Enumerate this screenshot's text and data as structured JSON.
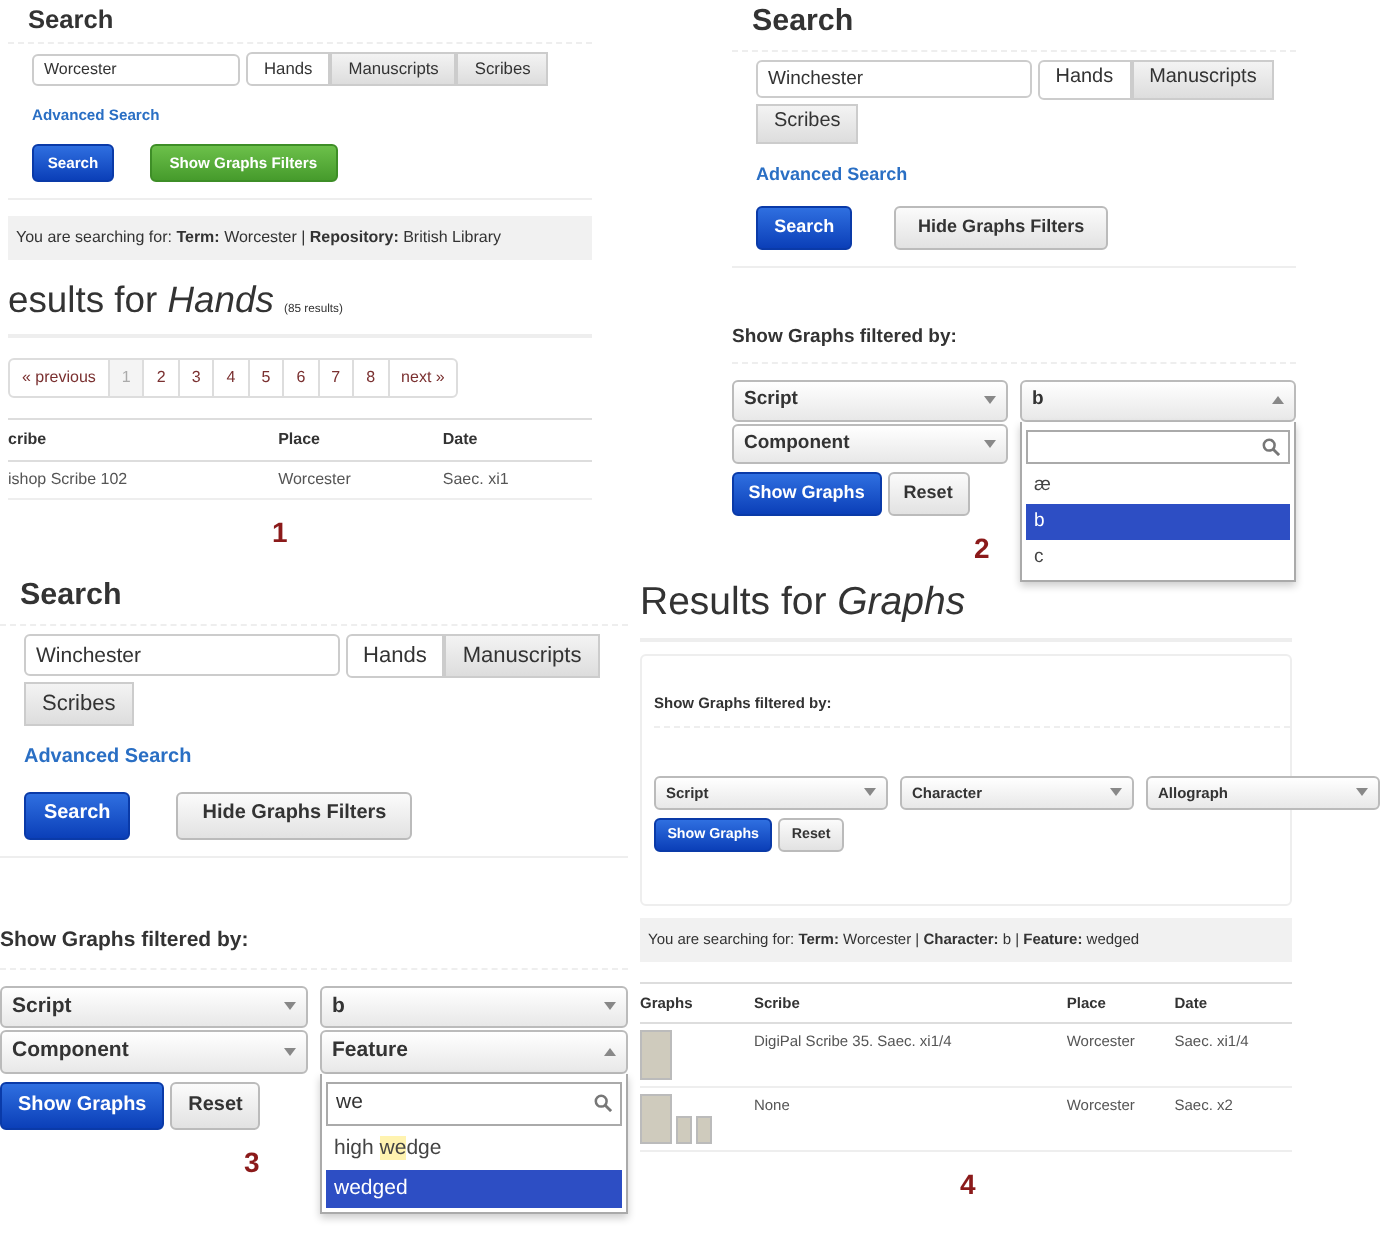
{
  "panels": [
    {
      "number": "1",
      "sections": [
        {
          "kind": "search",
          "heading": "Search",
          "query": "Worcester",
          "types": [
            {
              "label": "Hands",
              "selected": true
            },
            {
              "label": "Manuscripts",
              "selected": false
            },
            {
              "label": "Scribes",
              "selected": false
            }
          ],
          "advanced": "Advanced Search",
          "search_label": "Search",
          "toggle": {
            "label": "Show Graphs Filters",
            "kind": "show"
          }
        },
        {
          "kind": "summary",
          "text": "You are searching for: **Term:** Worcester | **Repository:** British Library"
        },
        {
          "kind": "results_title",
          "title": "esults for *Hands*",
          "count": "(85 results)"
        },
        {
          "kind": "pagination",
          "pages": [
            {
              "label": "« previous",
              "selected": false
            },
            {
              "label": "1",
              "selected": true
            },
            {
              "label": "2",
              "selected": false
            },
            {
              "label": "3",
              "selected": false
            },
            {
              "label": "4",
              "selected": false
            },
            {
              "label": "5",
              "selected": false
            },
            {
              "label": "6",
              "selected": false
            },
            {
              "label": "7",
              "selected": false
            },
            {
              "label": "8",
              "selected": false
            },
            {
              "label": "next »",
              "selected": false
            }
          ]
        },
        {
          "kind": "table",
          "columns": [
            "cribe",
            "Place",
            "Date"
          ],
          "rows": [
            {
              "cells": [
                {
                  "kind": "text",
                  "text": "ishop Scribe 102"
                },
                {
                  "kind": "text",
                  "text": "Worcester"
                },
                {
                  "kind": "text",
                  "text": "Saec. xi1"
                }
              ]
            }
          ]
        }
      ]
    },
    {
      "number": "2",
      "sections": [
        {
          "kind": "search",
          "heading": "Search",
          "query": "Winchester",
          "types": [
            {
              "label": "Hands",
              "selected": true
            },
            {
              "label": "Manuscripts",
              "selected": false
            },
            {
              "label": "Scribes",
              "selected": false
            }
          ],
          "advanced": "Advanced Search",
          "search_label": "Search",
          "toggle": {
            "label": "Hide Graphs Filters",
            "kind": "hide"
          }
        },
        {
          "kind": "filters",
          "title": "Show Graphs filtered by:",
          "boxed": false,
          "show_label": "Show Graphs",
          "reset_label": "Reset",
          "columns": [
            [
              {
                "label": "Script",
                "open": false
              },
              {
                "label": "Component",
                "open": false
              }
            ],
            [
              {
                "label": "b",
                "open": true,
                "options": [
                  {
                    "label": "æ",
                    "selected": false
                  },
                  {
                    "label": "b",
                    "selected": true
                  },
                  {
                    "label": "c",
                    "selected": false
                  }
                ]
              }
            ]
          ]
        }
      ]
    },
    {
      "number": "3",
      "sections": [
        {
          "kind": "search",
          "heading": "Search",
          "query": "Winchester",
          "types": [
            {
              "label": "Hands",
              "selected": true
            },
            {
              "label": "Manuscripts",
              "selected": false
            },
            {
              "label": "Scribes",
              "selected": false
            }
          ],
          "advanced": "Advanced Search",
          "search_label": "Search",
          "toggle": {
            "label": "Hide Graphs Filters",
            "kind": "hide"
          }
        },
        {
          "kind": "filters",
          "title": "Show Graphs filtered by:",
          "boxed": false,
          "show_label": "Show Graphs",
          "reset_label": "Reset",
          "columns": [
            [
              {
                "label": "Script",
                "open": false
              },
              {
                "label": "Component",
                "open": false
              }
            ],
            [
              {
                "label": "b",
                "open": false
              },
              {
                "label": "Feature",
                "open": true,
                "search": "we",
                "options": [
                  {
                    "parts": [
                      {
                        "text": "high "
                      },
                      {
                        "text": "we",
                        "highlight": true
                      },
                      {
                        "text": "dge"
                      }
                    ],
                    "selected": false
                  },
                  {
                    "label": "wedged",
                    "selected": true
                  }
                ]
              }
            ]
          ]
        }
      ]
    },
    {
      "number": "4",
      "sections": [
        {
          "kind": "results_title",
          "title": "Results for *Graphs*"
        },
        {
          "kind": "filters",
          "title": "Show Graphs filtered by:",
          "boxed": true,
          "show_label": "Show Graphs",
          "reset_label": "Reset",
          "columns": [
            [
              {
                "label": "Script",
                "open": false
              }
            ],
            [
              {
                "label": "Character",
                "open": false
              }
            ],
            [
              {
                "label": "Allograph",
                "open": false
              }
            ]
          ]
        },
        {
          "kind": "summary",
          "text": "You are searching for: **Term:** Worcester | **Character:** b | **Feature:** wedged"
        },
        {
          "kind": "table",
          "columns": [
            "Graphs",
            "Scribe",
            "Place",
            "Date"
          ],
          "rows": [
            {
              "cells": [
                {
                  "kind": "images",
                  "items": [
                    {
                      "kind": "large"
                    }
                  ]
                },
                {
                  "kind": "text",
                  "text": "DigiPal Scribe 35. Saec. xi1/4"
                },
                {
                  "kind": "text",
                  "text": "Worcester"
                },
                {
                  "kind": "text",
                  "text": "Saec. xi1/4"
                }
              ]
            },
            {
              "cells": [
                {
                  "kind": "images",
                  "items": [
                    {
                      "kind": "large"
                    },
                    {
                      "kind": "small"
                    },
                    {
                      "kind": "small"
                    }
                  ]
                },
                {
                  "kind": "text",
                  "text": "None"
                },
                {
                  "kind": "text",
                  "text": "Worcester"
                },
                {
                  "kind": "text",
                  "text": "Saec. x2"
                }
              ]
            }
          ]
        }
      ]
    }
  ]
}
